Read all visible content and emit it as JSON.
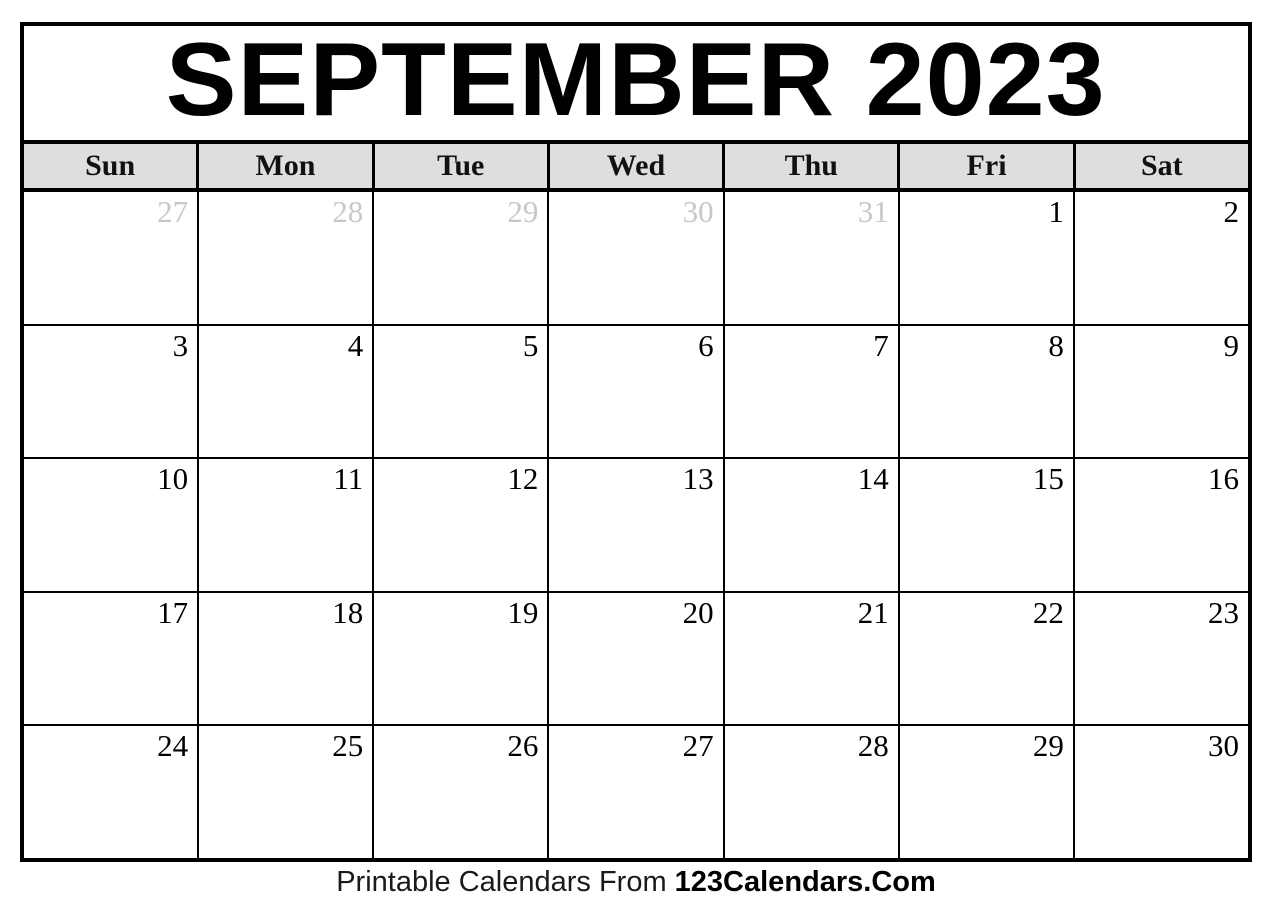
{
  "calendar": {
    "title": "SEPTEMBER 2023",
    "month_name": "SEPTEMBER",
    "year": "2023",
    "weekday_headers": [
      {
        "label": "Sun"
      },
      {
        "label": "Mon"
      },
      {
        "label": "Tue"
      },
      {
        "label": "Wed"
      },
      {
        "label": "Thu"
      },
      {
        "label": "Fri"
      },
      {
        "label": "Sat"
      }
    ],
    "weeks": [
      {
        "days": [
          {
            "number": "27",
            "in_month": false
          },
          {
            "number": "28",
            "in_month": false
          },
          {
            "number": "29",
            "in_month": false
          },
          {
            "number": "30",
            "in_month": false
          },
          {
            "number": "31",
            "in_month": false
          },
          {
            "number": "1",
            "in_month": true
          },
          {
            "number": "2",
            "in_month": true
          }
        ]
      },
      {
        "days": [
          {
            "number": "3",
            "in_month": true
          },
          {
            "number": "4",
            "in_month": true
          },
          {
            "number": "5",
            "in_month": true
          },
          {
            "number": "6",
            "in_month": true
          },
          {
            "number": "7",
            "in_month": true
          },
          {
            "number": "8",
            "in_month": true
          },
          {
            "number": "9",
            "in_month": true
          }
        ]
      },
      {
        "days": [
          {
            "number": "10",
            "in_month": true
          },
          {
            "number": "11",
            "in_month": true
          },
          {
            "number": "12",
            "in_month": true
          },
          {
            "number": "13",
            "in_month": true
          },
          {
            "number": "14",
            "in_month": true
          },
          {
            "number": "15",
            "in_month": true
          },
          {
            "number": "16",
            "in_month": true
          }
        ]
      },
      {
        "days": [
          {
            "number": "17",
            "in_month": true
          },
          {
            "number": "18",
            "in_month": true
          },
          {
            "number": "19",
            "in_month": true
          },
          {
            "number": "20",
            "in_month": true
          },
          {
            "number": "21",
            "in_month": true
          },
          {
            "number": "22",
            "in_month": true
          },
          {
            "number": "23",
            "in_month": true
          }
        ]
      },
      {
        "days": [
          {
            "number": "24",
            "in_month": true
          },
          {
            "number": "25",
            "in_month": true
          },
          {
            "number": "26",
            "in_month": true
          },
          {
            "number": "27",
            "in_month": true
          },
          {
            "number": "28",
            "in_month": true
          },
          {
            "number": "29",
            "in_month": true
          },
          {
            "number": "30",
            "in_month": true
          }
        ]
      }
    ]
  },
  "footer": {
    "prefix": "Printable Calendars From ",
    "brand": "123Calendars.Com"
  },
  "colors": {
    "border": "#000000",
    "header_background": "#dedede",
    "in_month_text": "#000000",
    "other_month_text": "#c8c8c8",
    "page_background": "#ffffff"
  }
}
